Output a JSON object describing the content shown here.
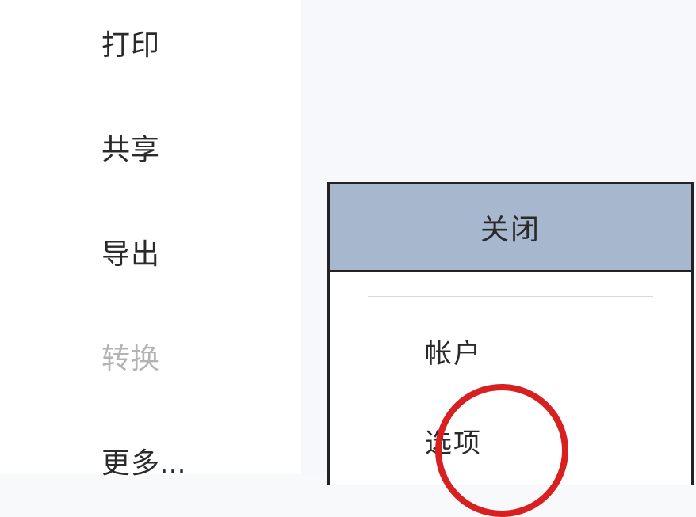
{
  "sidebar": {
    "items": [
      {
        "label": "打印",
        "disabled": false
      },
      {
        "label": "共享",
        "disabled": false
      },
      {
        "label": "导出",
        "disabled": false
      },
      {
        "label": "转换",
        "disabled": true
      },
      {
        "label": "更多...",
        "disabled": false
      }
    ]
  },
  "panel": {
    "header": "关闭",
    "items": [
      {
        "label": "帐户"
      },
      {
        "label": "选项"
      }
    ]
  }
}
